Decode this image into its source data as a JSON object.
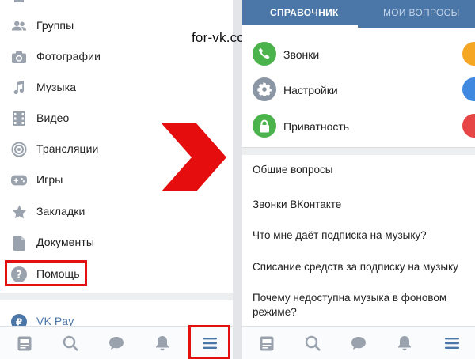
{
  "watermark": "for-vk.com",
  "left_menu": [
    {
      "label": "Группы",
      "icon": "groups-icon"
    },
    {
      "label": "Фотографии",
      "icon": "camera-icon"
    },
    {
      "label": "Музыка",
      "icon": "music-note-icon"
    },
    {
      "label": "Видео",
      "icon": "film-icon"
    },
    {
      "label": "Трансляции",
      "icon": "broadcast-icon"
    },
    {
      "label": "Игры",
      "icon": "gamepad-icon"
    },
    {
      "label": "Закладки",
      "icon": "star-icon"
    },
    {
      "label": "Документы",
      "icon": "document-icon"
    },
    {
      "label": "Помощь",
      "icon": "help-icon"
    }
  ],
  "vk_pay": {
    "label": "VK Pay",
    "icon": "vkpay-icon"
  },
  "tabs": {
    "active": "СПРАВОЧНИК",
    "inactive": "МОИ ВОПРОСЫ"
  },
  "categories": [
    {
      "label": "Звонки",
      "icon": "phone-icon",
      "color": "#4bb34b"
    },
    {
      "label": "Настройки",
      "icon": "gear-icon",
      "color": "#8a96a3"
    },
    {
      "label": "Приватность",
      "icon": "lock-icon",
      "color": "#4bb34b"
    }
  ],
  "edge_colors": [
    "#f5a623",
    "#3f8ae0",
    "#e64646"
  ],
  "questions": [
    "Общие вопросы",
    "Звонки ВКонтакте",
    "Что мне даёт подписка на музыку?",
    "Списание средств за подписку на музыку",
    "Почему недоступна музыка в фоновом режиме?"
  ],
  "bottom_tabs": [
    "news-icon",
    "search-icon",
    "messages-icon",
    "notifications-icon",
    "menu-icon"
  ],
  "colors": {
    "accent": "#4a76a8",
    "highlight": "#e41010",
    "icon_gray": "#99a2ad"
  }
}
